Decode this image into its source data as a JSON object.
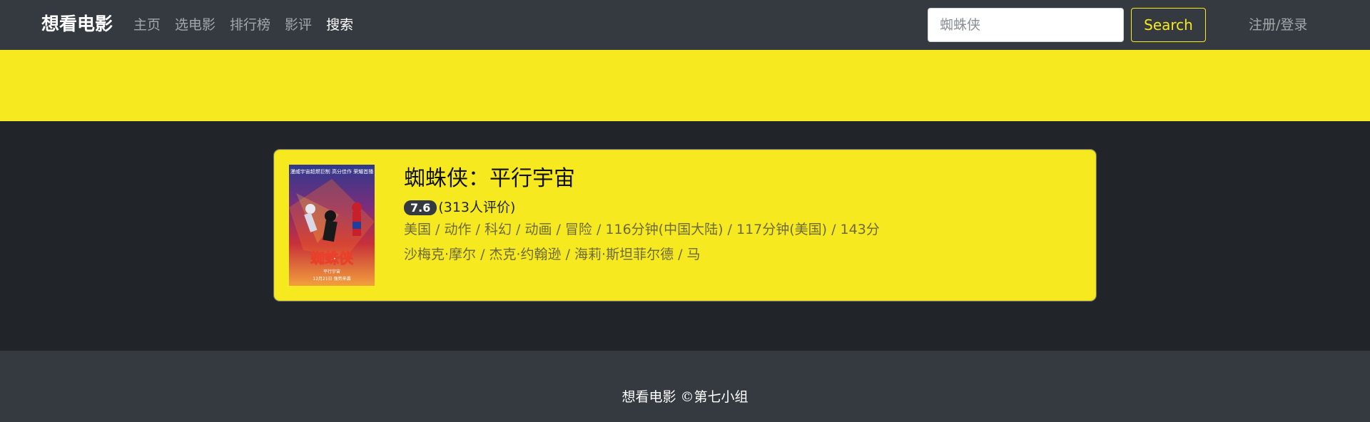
{
  "navbar": {
    "brand": "想看电影",
    "links": [
      "主页",
      "选电影",
      "排行榜",
      "影评",
      "搜索"
    ],
    "active_link": "搜索",
    "search": {
      "value": "",
      "placeholder": "蜘蛛侠"
    },
    "search_button": "Search",
    "login": "注册/登录"
  },
  "colors": {
    "navbar_bg": "#343a40",
    "page_bg": "#212529",
    "accent_yellow": "#f7e920"
  },
  "results": [
    {
      "title": "蜘蛛侠：平行宇宙",
      "rating": "7.6",
      "rating_count": "(313人评价)",
      "meta": "美国 / 动作 / 科幻 / 动画 / 冒险 / 116分钟(中国大陆) / 117分钟(美国) / 143分",
      "cast": "沙梅克·摩尔 / 杰克·约翰逊 / 海莉·斯坦菲尔德 / 马",
      "poster": {
        "title_text": "蜘蛛侠",
        "subtitle_text": "平行宇宙",
        "tagline": "漫威宇宙超燃巨制 高分佳作 荣耀首播",
        "date_text": "12月21日 强势来袭"
      }
    }
  ],
  "footer": {
    "text": "想看电影 ©第七小组"
  }
}
